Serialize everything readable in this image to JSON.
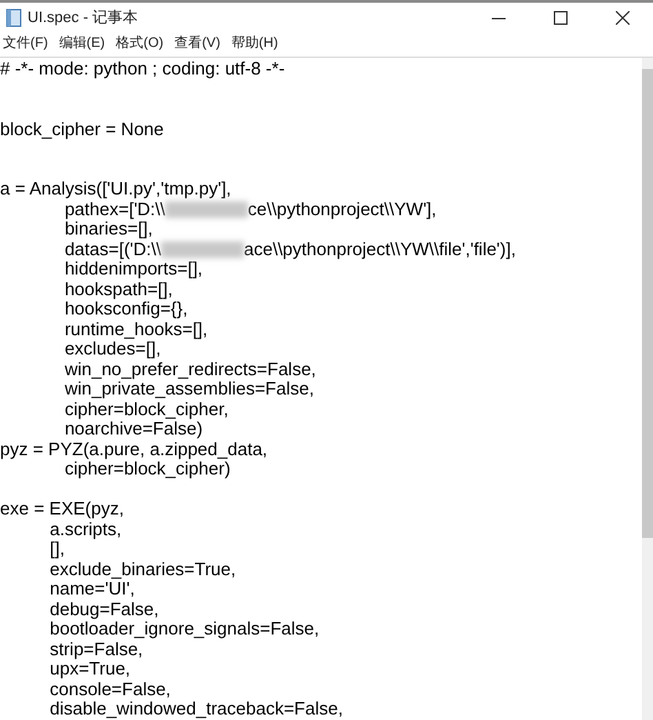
{
  "window": {
    "title": "UI.spec - 记事本"
  },
  "menu": [
    "文件(F)",
    "编辑(E)",
    "格式(O)",
    "查看(V)",
    "帮助(H)"
  ],
  "lines": [
    {
      "kind": "line",
      "text": "# -*- mode: python ; coding: utf-8 -*-"
    },
    {
      "kind": "section",
      "text": "block_cipher = None"
    },
    {
      "kind": "section",
      "text": "a = Analysis(['UI.py','tmp.py'],"
    },
    {
      "kind": "line",
      "text": "             pathex=['D:\\\\",
      "redacted": true,
      "rest": "ce\\\\pythonproject\\\\YW'],"
    },
    {
      "kind": "line",
      "text": "             binaries=[],"
    },
    {
      "kind": "line",
      "text": "             datas=[('D:\\\\",
      "redacted": true,
      "rest": "ace\\\\pythonproject\\\\YW\\\\file','file')],"
    },
    {
      "kind": "line",
      "text": "             hiddenimports=[],"
    },
    {
      "kind": "line",
      "text": "             hookspath=[],"
    },
    {
      "kind": "line",
      "text": "             hooksconfig={},"
    },
    {
      "kind": "line",
      "text": "             runtime_hooks=[],"
    },
    {
      "kind": "line",
      "text": "             excludes=[],"
    },
    {
      "kind": "line",
      "text": "             win_no_prefer_redirects=False,"
    },
    {
      "kind": "line",
      "text": "             win_private_assemblies=False,"
    },
    {
      "kind": "line",
      "text": "             cipher=block_cipher,"
    },
    {
      "kind": "line",
      "text": "             noarchive=False)"
    },
    {
      "kind": "line",
      "text": "pyz = PYZ(a.pure, a.zipped_data,"
    },
    {
      "kind": "line",
      "text": "             cipher=block_cipher)"
    },
    {
      "kind": "paragraph",
      "text": "exe = EXE(pyz,"
    },
    {
      "kind": "line",
      "text": "          a.scripts,"
    },
    {
      "kind": "line",
      "text": "          [],"
    },
    {
      "kind": "line",
      "text": "          exclude_binaries=True,"
    },
    {
      "kind": "line",
      "text": "          name='UI',"
    },
    {
      "kind": "line",
      "text": "          debug=False,"
    },
    {
      "kind": "line",
      "text": "          bootloader_ignore_signals=False,"
    },
    {
      "kind": "line",
      "text": "          strip=False,"
    },
    {
      "kind": "line",
      "text": "          upx=True,"
    },
    {
      "kind": "line",
      "text": "          console=False,"
    },
    {
      "kind": "line",
      "text": "          disable_windowed_traceback=False,"
    }
  ]
}
